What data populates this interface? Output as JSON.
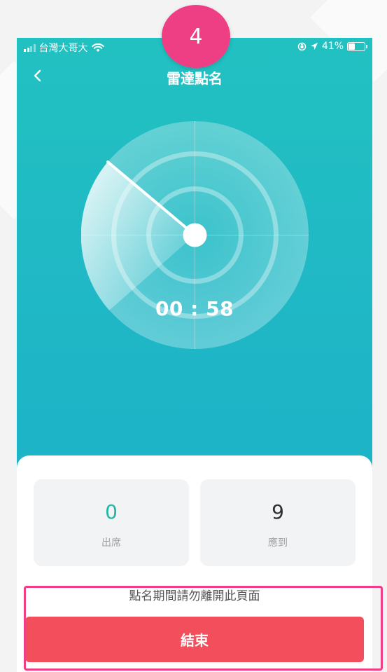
{
  "step_badge": "4",
  "status_bar": {
    "carrier": "台灣大哥大",
    "battery_percent": "41%",
    "battery_level": 0.41
  },
  "nav": {
    "title": "雷達點名"
  },
  "timer": "00 : 58",
  "stats": {
    "attended": {
      "value": "0",
      "label": "出席"
    },
    "expected": {
      "value": "9",
      "label": "應到"
    }
  },
  "warning": "點名期間請勿離開此頁面",
  "end_button": "結束",
  "colors": {
    "header_gradient_top": "#22c1c1",
    "header_gradient_bottom": "#1cb1c9",
    "attended_accent": "#1fb7a6",
    "end_button": "#f24e5b",
    "annotation_pink": "#ee3f84"
  },
  "icons": {
    "back": "chevron-left-icon",
    "wifi": "wifi-icon",
    "location": "location-arrow-icon",
    "orientation_lock": "orientation-lock-icon"
  }
}
